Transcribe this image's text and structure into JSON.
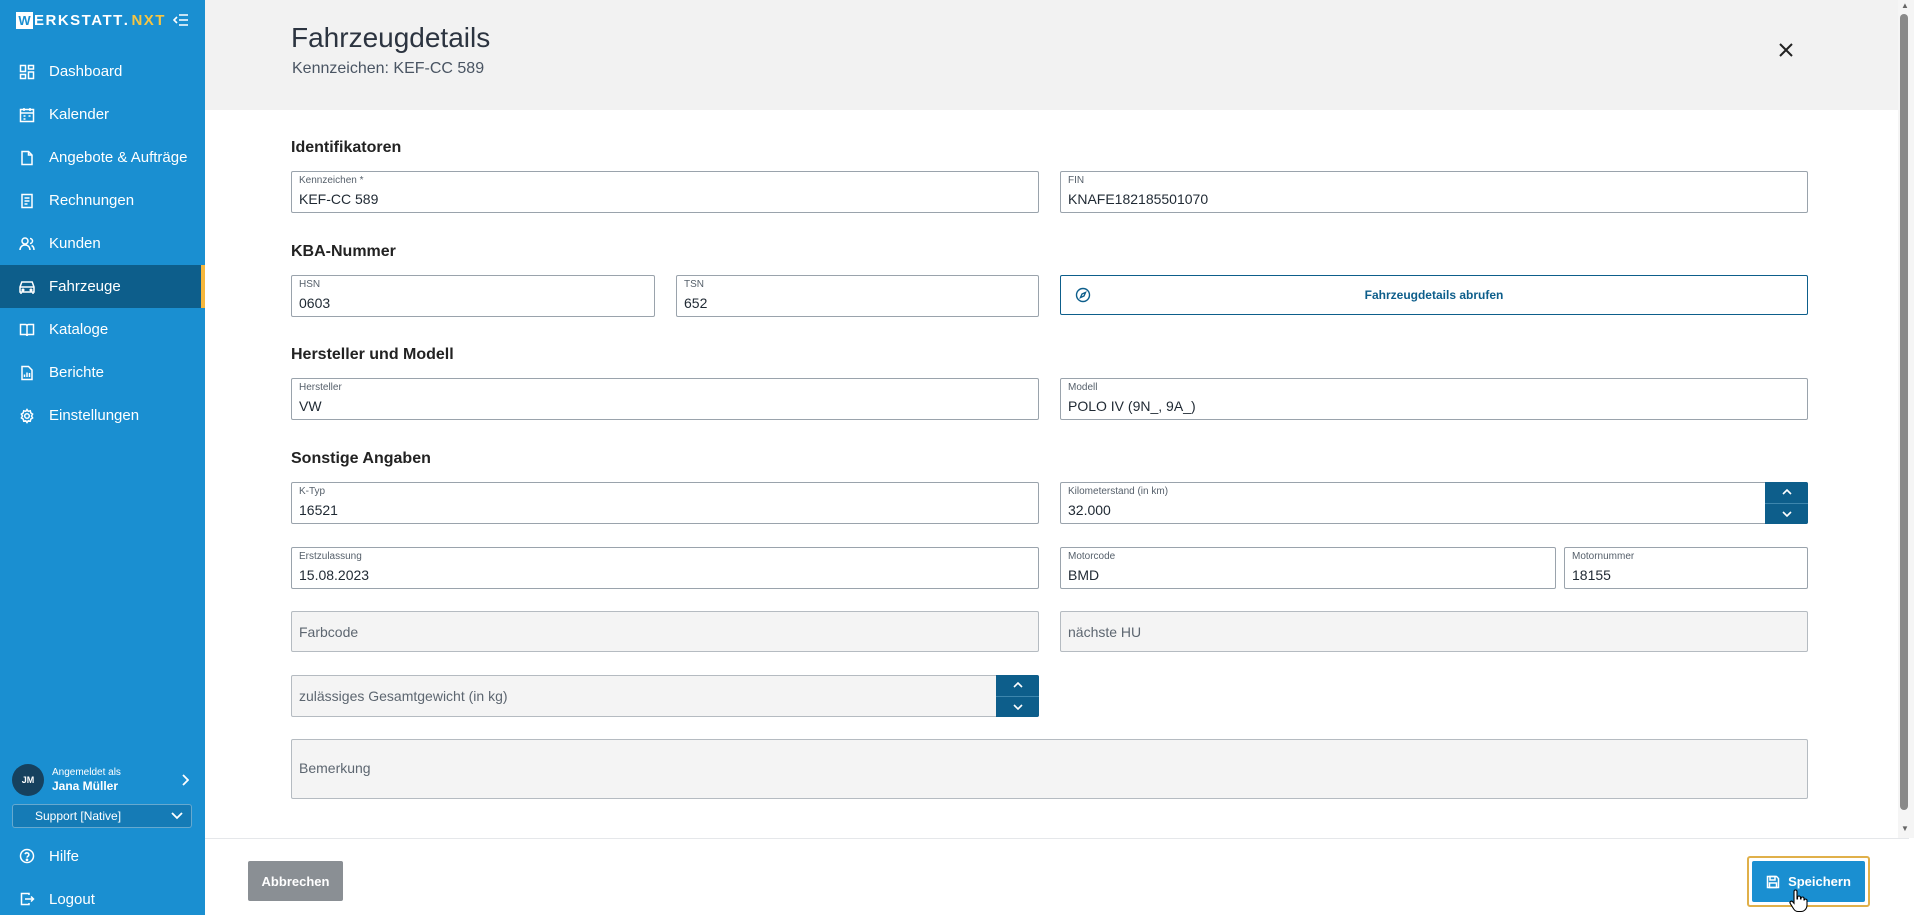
{
  "app": {
    "logo_w": "W",
    "logo_rest": "ERKSTATT",
    "logo_dot": ".",
    "logo_suffix": "NXT"
  },
  "sidebar": {
    "items": [
      {
        "label": "Dashboard",
        "icon": "dashboard-icon"
      },
      {
        "label": "Kalender",
        "icon": "calendar-icon"
      },
      {
        "label": "Angebote & Aufträge",
        "icon": "document-icon"
      },
      {
        "label": "Rechnungen",
        "icon": "invoice-icon"
      },
      {
        "label": "Kunden",
        "icon": "users-icon"
      },
      {
        "label": "Fahrzeuge",
        "icon": "car-icon",
        "active": true
      },
      {
        "label": "Kataloge",
        "icon": "book-icon"
      },
      {
        "label": "Berichte",
        "icon": "report-icon"
      },
      {
        "label": "Einstellungen",
        "icon": "gear-icon"
      }
    ],
    "user": {
      "initials": "JM",
      "logged_in_label": "Angemeldet als",
      "name": "Jana Müller"
    },
    "support_select": "Support [Native]",
    "help": "Hilfe",
    "logout": "Logout"
  },
  "header": {
    "title": "Fahrzeugdetails",
    "subtitle": "Kennzeichen: KEF-CC 589"
  },
  "sections": {
    "identifikatoren": "Identifikatoren",
    "kba": "KBA-Nummer",
    "hersteller_modell": "Hersteller und Modell",
    "sonstige": "Sonstige Angaben"
  },
  "fields": {
    "kennzeichen": {
      "label": "Kennzeichen *",
      "value": "KEF-CC 589"
    },
    "fin": {
      "label": "FIN",
      "value": "KNAFE182185501070"
    },
    "hsn": {
      "label": "HSN",
      "value": "0603"
    },
    "tsn": {
      "label": "TSN",
      "value": "652"
    },
    "hersteller": {
      "label": "Hersteller",
      "value": "VW"
    },
    "modell": {
      "label": "Modell",
      "value": "POLO IV (9N_, 9A_)"
    },
    "ktyp": {
      "label": "K-Typ",
      "value": "16521"
    },
    "kilometerstand": {
      "label": "Kilometerstand (in km)",
      "value": "32.000"
    },
    "erstzulassung": {
      "label": "Erstzulassung",
      "value": "15.08.2023"
    },
    "motorcode": {
      "label": "Motorcode",
      "value": "BMD"
    },
    "motornummer": {
      "label": "Motornummer",
      "value": "18155"
    },
    "farbcode": {
      "placeholder": "Farbcode"
    },
    "naechste_hu": {
      "placeholder": "nächste HU"
    },
    "gesamtgewicht": {
      "placeholder": "zulässiges Gesamtgewicht (in kg)"
    },
    "bemerkung": {
      "placeholder": "Bemerkung"
    }
  },
  "buttons": {
    "fetch": "Fahrzeugdetails abrufen",
    "cancel": "Abbrechen",
    "save": "Speichern"
  },
  "colors": {
    "sidebar": "#1a8fd1",
    "active_nav": "#0d5e8b",
    "accent_yellow": "#f6b73c",
    "cancel_grey": "#8a8f94"
  }
}
